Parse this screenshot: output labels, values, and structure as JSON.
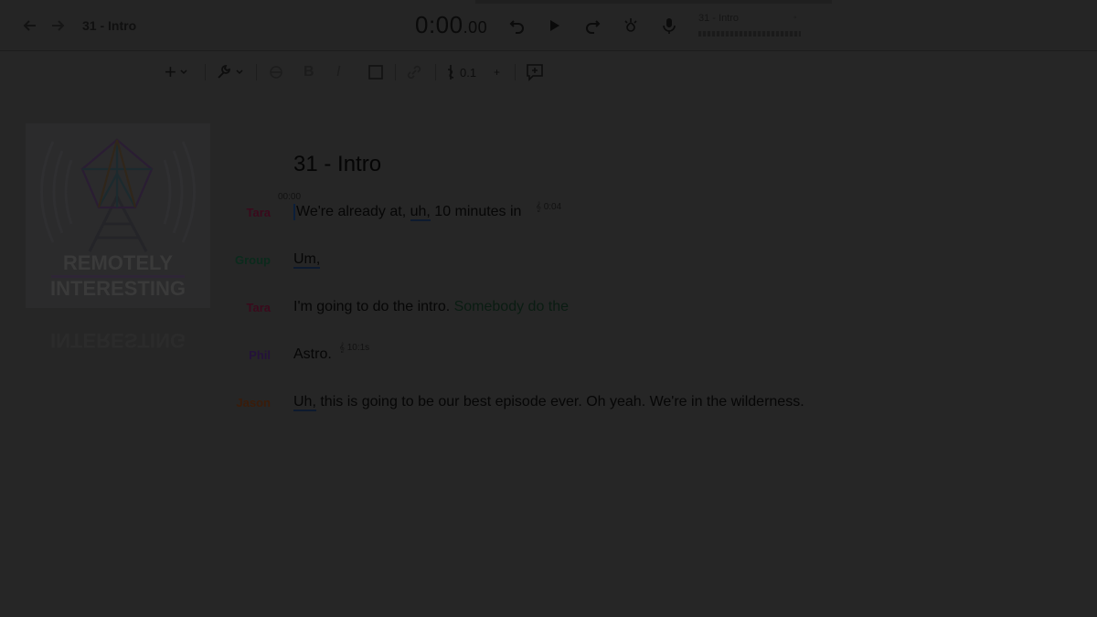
{
  "app": {
    "document_title": "31 - Intro",
    "timecode_main": "0:00",
    "timecode_fraction": ".00",
    "mini_player_title": "31 - Intro"
  },
  "icons": {
    "back": "arrow-left-icon",
    "forward": "arrow-right-icon",
    "rewind": "rewind-icon",
    "play": "play-icon",
    "fast_forward": "fast-forward-icon",
    "effects": "sparkle-icon",
    "record": "microphone-icon"
  },
  "toolbar": {
    "insert_label": "+",
    "speed_value": "0.1",
    "speed_stepper": "+"
  },
  "artwork": {
    "line1": "REMOTELY",
    "line2": "INTERESTING"
  },
  "transcript": {
    "heading": "31 - Intro",
    "start_time": "00:00",
    "lines": [
      {
        "speaker": "Tara",
        "color": "#3a0a1c",
        "parts": {
          "a": "We're already at, ",
          "filler": "uh,",
          "b": " 10 minutes in"
        },
        "marker": "0:04"
      },
      {
        "speaker": "Group",
        "color": "#0b2a1c",
        "parts": {
          "a": "",
          "filler": "Um,",
          "b": ""
        }
      },
      {
        "speaker": "Tara",
        "color": "#3a0a1c",
        "parts": {
          "a": "I'm going to do the intro. ",
          "b": "Somebody do the"
        }
      },
      {
        "speaker": "Phil",
        "color": "#24123a",
        "parts": {
          "a": "Astro."
        },
        "marker": "10:1s"
      },
      {
        "speaker": "Jason",
        "color": "#3a1c0a",
        "parts": {
          "filler": "Uh,",
          "b": " this is going to be our best episode ever. Oh yeah. We're in the wilderness."
        }
      }
    ]
  }
}
